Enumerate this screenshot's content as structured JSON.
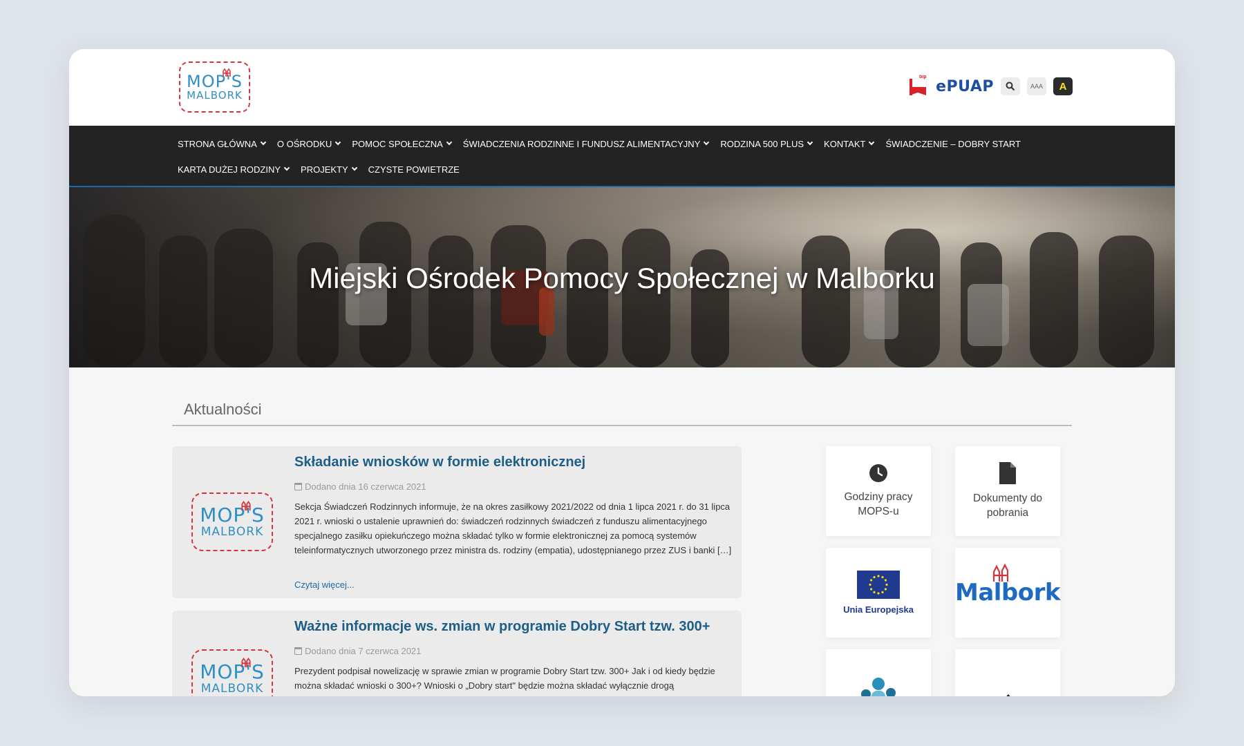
{
  "header": {
    "logo_line1": "MOP'S",
    "logo_line2": "MALBORK",
    "bip_label": "bip",
    "epuap_label": "ePUAP",
    "font_size_label": "AAA",
    "contrast_label": "A"
  },
  "nav": {
    "items": [
      {
        "label": "STRONA GŁÓWNA",
        "dropdown": true
      },
      {
        "label": "O OŚRODKU",
        "dropdown": true
      },
      {
        "label": "POMOC SPOŁECZNA",
        "dropdown": true
      },
      {
        "label": "ŚWIADCZENIA RODZINNE I FUNDUSZ ALIMENTACYJNY",
        "dropdown": true
      },
      {
        "label": "RODZINA 500 PLUS",
        "dropdown": true
      },
      {
        "label": "KONTAKT",
        "dropdown": true
      },
      {
        "label": "ŚWIADCZENIE – DOBRY START",
        "dropdown": false
      },
      {
        "label": "KARTA DUŻEJ RODZINY",
        "dropdown": true
      },
      {
        "label": "PROJEKTY",
        "dropdown": true
      },
      {
        "label": "CZYSTE POWIETRZE",
        "dropdown": false
      }
    ]
  },
  "hero": {
    "title": "Miejski Ośrodek Pomocy Społecznej w Malborku"
  },
  "news": {
    "heading": "Aktualności",
    "posts": [
      {
        "title": "Składanie wniosków w formie elektronicznej",
        "date": "Dodano dnia 16 czerwca 2021",
        "excerpt": "Sekcja Świadczeń Rodzinnych informuje, że na okres zasiłkowy 2021/2022 od dnia 1 lipca 2021 r. do 31 lipca 2021 r. wnioski o ustalenie uprawnień do: świadczeń rodzinnych świadczeń z funduszu alimentacyjnego specjalnego zasiłku opiekuńczego można składać tylko w formie elektronicznej za pomocą systemów teleinformatycznych utworzonego przez ministra ds. rodziny (empatia), udostępnianego przez ZUS i banki […]",
        "more": "Czytaj więcej..."
      },
      {
        "title": "Ważne informacje ws. zmian w programie Dobry Start tzw. 300+",
        "date": "Dodano dnia 7 czerwca 2021",
        "excerpt": "Prezydent podpisał nowelizację w sprawie zmian w programie Dobry Start tzw. 300+ Jak i od kiedy będzie można składać wnioski o 300+? Wnioski o „Dobry start\" będzie można składać wyłącznie drogą"
      }
    ]
  },
  "sidebar": {
    "tiles": [
      {
        "label": "Godziny pracy MOPS-u",
        "icon": "clock-icon"
      },
      {
        "label": "Dokumenty do pobrania",
        "icon": "document-icon"
      },
      {
        "label": "Unia Europejska",
        "icon": "eu-flag-icon"
      },
      {
        "label": "Malbork",
        "icon": "malbork-logo"
      }
    ]
  },
  "colors": {
    "accent": "#1d5e88",
    "nav_bg": "#232323",
    "logo_red": "#d8333a",
    "logo_blue": "#2f8fc2"
  }
}
